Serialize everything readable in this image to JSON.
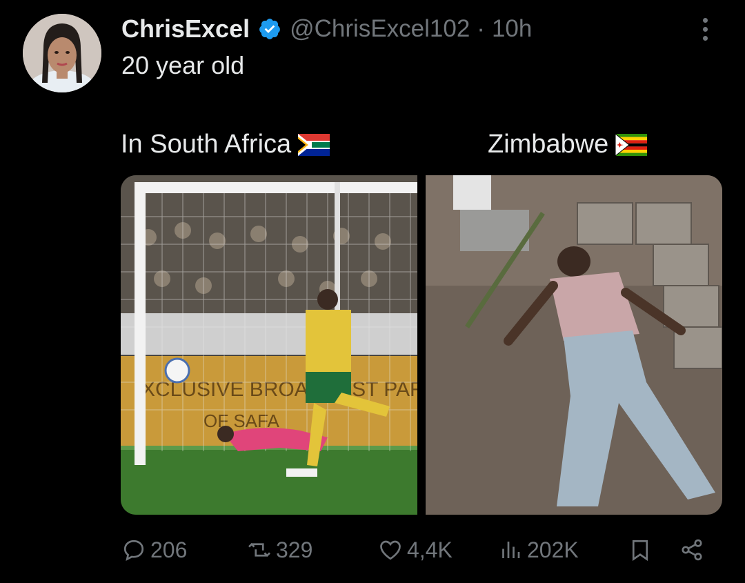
{
  "tweet": {
    "display_name": "ChrisExcel",
    "handle": "@ChrisExcel102",
    "separator": "·",
    "time": "10h",
    "text": "20 year old",
    "verified": true,
    "verified_color": "#1d9bf0"
  },
  "media": {
    "left_label": "In South Africa",
    "left_flag": "south-africa-flag-icon",
    "right_label": "Zimbabwe",
    "right_flag": "zimbabwe-flag-icon"
  },
  "actions": {
    "replies": "206",
    "reposts": "329",
    "likes": "4,4K",
    "views": "202K"
  },
  "colors": {
    "background": "#000000",
    "text": "#e7e9ea",
    "muted": "#71767b",
    "accent": "#1d9bf0"
  }
}
